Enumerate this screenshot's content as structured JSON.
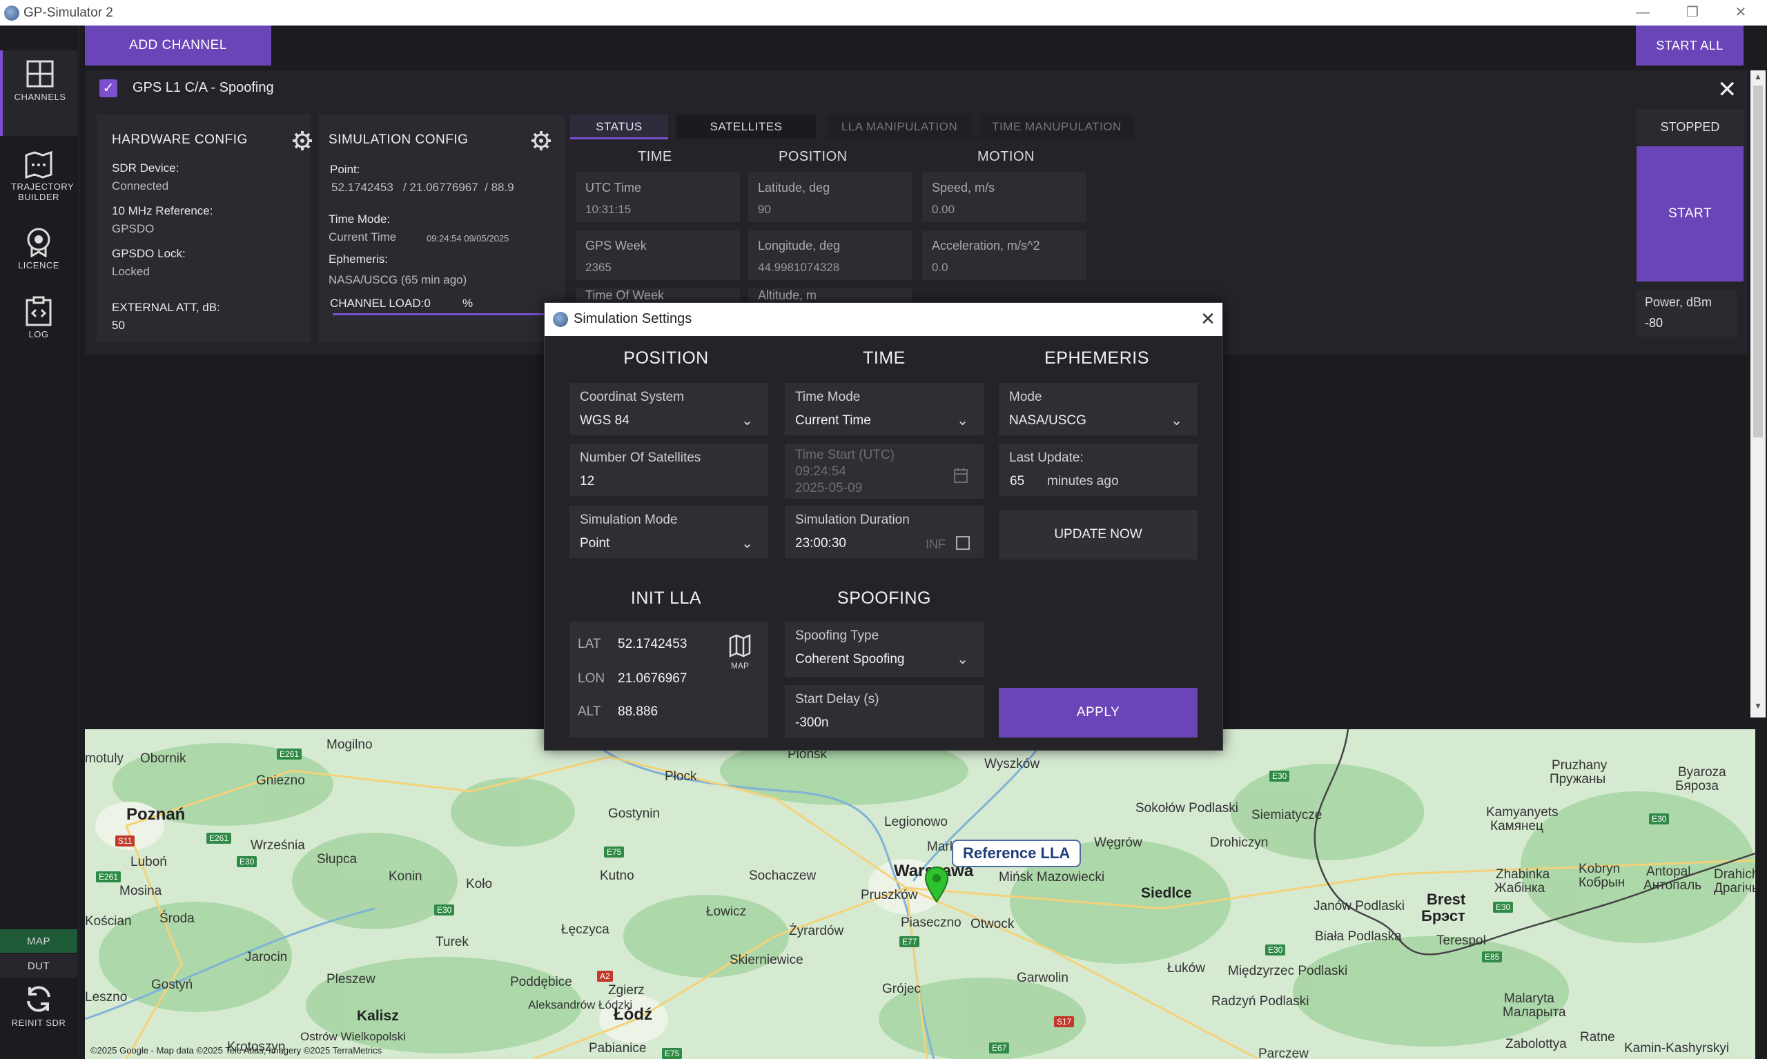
{
  "window": {
    "title": "GP-Simulator 2",
    "minimize": "—",
    "restore": "❐",
    "close": "✕"
  },
  "nav": {
    "channels": "CHANNELS",
    "trajectory": "TRAJECTORY BUILDER",
    "licence": "LICENCE",
    "log": "LOG",
    "map": "MAP",
    "dut": "DUT",
    "reinit": "REINIT SDR"
  },
  "toolbar": {
    "add_channel": "ADD CHANNEL",
    "start_all": "START ALL"
  },
  "channel": {
    "name": "GPS L1 C/A - Spoofing",
    "check": "✓",
    "close": "✕",
    "hardware": {
      "title": "HARDWARE CONFIG",
      "sdr_label": "SDR Device:",
      "sdr_value": "Connected",
      "ref_label": "10 MHz Reference:",
      "ref_value": "GPSDO",
      "lock_label": "GPSDO Lock:",
      "lock_value": "Locked",
      "att_label": "EXTERNAL ATT, dB:",
      "att_value": "50"
    },
    "simulation": {
      "title": "SIMULATION CONFIG",
      "point_label": "Point:",
      "point_value": "52.1742453   / 21.06776967  / 88.9",
      "time_mode_label": "Time Mode:",
      "time_mode_value": "Current Time",
      "time_stamp": "09:24:54  09/05/2025",
      "ephemeris_label": "Ephemeris:",
      "ephemeris_value": "NASA/USCG (65 min ago)",
      "load_label": "CHANNEL LOAD:0",
      "load_unit": "%"
    },
    "tabs": [
      "STATUS",
      "SATELLITES",
      "LLA MANIPULATION",
      "TIME MANUPULATION"
    ],
    "status": {
      "time_head": "TIME",
      "position_head": "POSITION",
      "motion_head": "MOTION",
      "utc_label": "UTC Time",
      "utc_value": "10:31:15",
      "week_label": "GPS Week",
      "week_value": "2365",
      "tow_label": "Time Of Week",
      "lat_label": "Latitude, deg",
      "lat_value": "90",
      "lon_label": "Longitude, deg",
      "lon_value": "44.9981074328",
      "alt_label": "Altitude, m",
      "speed_label": "Speed, m/s",
      "speed_value": "0.00",
      "acc_label": "Acceleration, m/s^2",
      "acc_value": "0.0"
    },
    "state": "STOPPED",
    "start": "START",
    "power_label": "Power, dBm",
    "power_value": "-80"
  },
  "dialog": {
    "title": "Simulation Settings",
    "close": "✕",
    "position": {
      "head": "POSITION",
      "coord_label": "Coordinat System",
      "coord_value": "WGS 84",
      "sats_label": "Number Of Satellites",
      "sats_value": "12",
      "mode_label": "Simulation Mode",
      "mode_value": "Point"
    },
    "time": {
      "head": "TIME",
      "mode_label": "Time Mode",
      "mode_value": "Current Time",
      "start_label": "Time Start (UTC)",
      "start_time": "09:24:54",
      "start_date": "2025-05-09",
      "duration_label": "Simulation Duration",
      "duration_value": "23:00:30",
      "inf_label": "INF"
    },
    "ephemeris": {
      "head": "EPHEMERIS",
      "mode_label": "Mode",
      "mode_value": "NASA/USCG",
      "update_label": "Last Update:",
      "update_value": "65",
      "update_unit": "minutes ago",
      "update_now": "UPDATE NOW"
    },
    "init_lla": {
      "head": "INIT LLA",
      "lat_label": "LAT",
      "lat_value": "52.1742453",
      "lon_label": "LON",
      "lon_value": "21.0676967",
      "alt_label": "ALT",
      "alt_value": "88.886",
      "map_label": "MAP"
    },
    "spoofing": {
      "head": "SPOOFING",
      "type_label": "Spoofing Type",
      "type_value": "Coherent Spoofing",
      "delay_label": "Start Delay (s)",
      "delay_value": "-300n"
    },
    "apply": "APPLY"
  },
  "map": {
    "marker_label": "Reference LLA",
    "attribution": "©2025 Google - Map data ©2025 Tele Atlas, Imagery ©2025 TerraMetrics",
    "cities": [
      "Poznań",
      "Gniezno",
      "Mogilno",
      "Obornik",
      "motuly",
      "Września",
      "Słupca",
      "Konin",
      "Koło",
      "Płock",
      "Gostynin",
      "Kutno",
      "Łowicz",
      "Łęczyca",
      "Sochaczew",
      "Żyrardów",
      "Skierniewice",
      "Łódź",
      "Zgierz",
      "Aleksandrów Łódzki",
      "Pabianice",
      "Kalisz",
      "Krotoszyn",
      "Ostrów Wielkopolski",
      "Pleszew",
      "Jarocin",
      "Turek",
      "Środa",
      "Mosina",
      "Luboń",
      "Kościan",
      "Gostyń",
      "Leszno",
      "Poddębice",
      "Plońsk",
      "Wyszków",
      "Legionowo",
      "Warszawa",
      "Pruszków",
      "Piaseczno",
      "Otwock",
      "Mińsk Mazowiecki",
      "Węgrów",
      "Sokołów Podlaski",
      "Siemiatycze",
      "Drohiczyn",
      "Siedlce",
      "Garwolin",
      "Łuków",
      "Międzyrzec Podlaski",
      "Radzyń Podlaski",
      "Biała Podlaska",
      "Janów Podlaski",
      "Terespol",
      "Brest",
      "Брэст",
      "Kamyanyets",
      "Камянец",
      "Pruzhany",
      "Пружаны",
      "Byaroza",
      "Бяроза",
      "Zhabinka",
      "Жабiнка",
      "Kobryn",
      "Кобрын",
      "Antopal",
      "Антопаль",
      "Drahichyn",
      "Драгiчын",
      "Malaryta",
      "Маларыта",
      "Ratne",
      "Kamin-Kashyrskyi",
      "Zabolottya",
      "Grójec",
      "Marki",
      "Parczew"
    ],
    "roads": [
      "E261",
      "E261",
      "S11",
      "E30",
      "E261",
      "E30",
      "E75",
      "A2",
      "E75",
      "E77",
      "E67",
      "S17",
      "E30",
      "E30",
      "E85",
      "E30",
      "E30"
    ]
  }
}
